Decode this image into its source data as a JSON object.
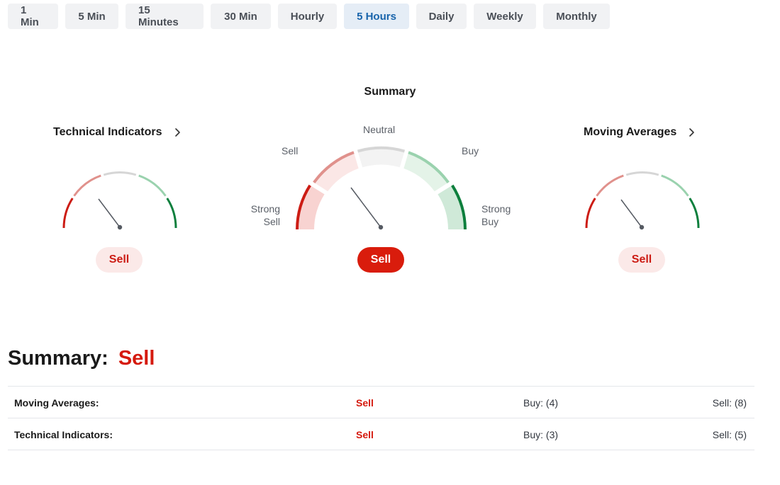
{
  "tabs": [
    {
      "label": "1 Min",
      "active": false
    },
    {
      "label": "5 Min",
      "active": false
    },
    {
      "label": "15 Minutes",
      "active": false
    },
    {
      "label": "30 Min",
      "active": false
    },
    {
      "label": "Hourly",
      "active": false
    },
    {
      "label": "5 Hours",
      "active": true
    },
    {
      "label": "Daily",
      "active": false
    },
    {
      "label": "Weekly",
      "active": false
    },
    {
      "label": "Monthly",
      "active": false
    }
  ],
  "gauges": {
    "technical": {
      "title": "Technical Indicators",
      "signal": "Sell",
      "chevron": "chevron-right-icon"
    },
    "summary": {
      "title": "Summary",
      "signal": "Sell",
      "labels": {
        "strong_sell": [
          "Strong",
          "Sell"
        ],
        "sell": "Sell",
        "neutral": "Neutral",
        "buy": "Buy",
        "strong_buy": [
          "Strong",
          "Buy"
        ]
      }
    },
    "moving": {
      "title": "Moving Averages",
      "signal": "Sell",
      "chevron": "chevron-right-icon"
    }
  },
  "summary": {
    "label": "Summary:",
    "value": "Sell",
    "rows": [
      {
        "name": "Moving Averages:",
        "action": "Sell",
        "buy": "Buy: (4)",
        "sell": "Sell: (8)"
      },
      {
        "name": "Technical Indicators:",
        "action": "Sell",
        "buy": "Buy: (3)",
        "sell": "Sell: (5)"
      }
    ]
  },
  "colors": {
    "strong_sell": "#cc1c14",
    "sell": "#e0918c",
    "neutral": "#d6d6d6",
    "buy": "#9ad2ae",
    "strong_buy": "#0d7f3d",
    "signal_red": "#d51a0e",
    "active_tab": "#1864ab"
  }
}
